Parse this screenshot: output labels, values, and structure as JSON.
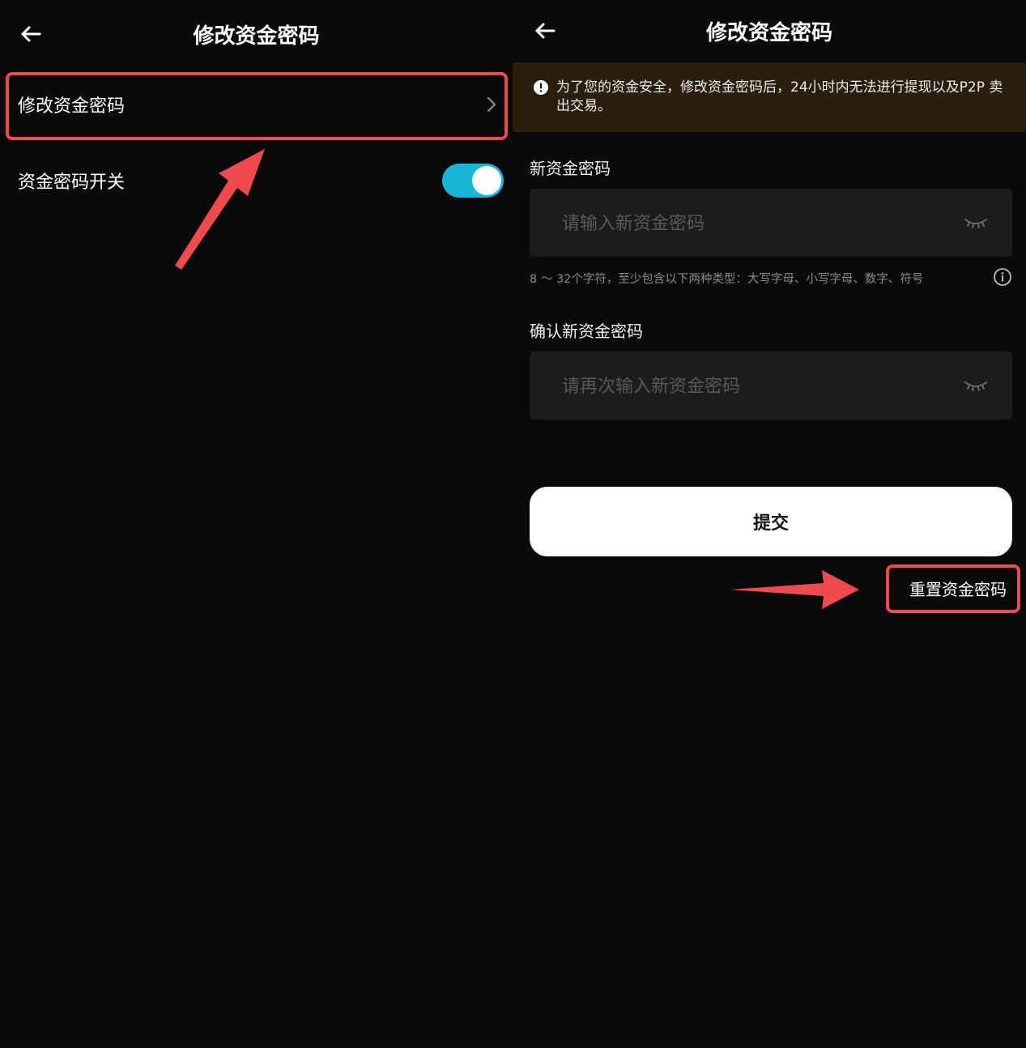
{
  "left": {
    "title": "修改资金密码",
    "rows": [
      {
        "label": "修改资金密码"
      },
      {
        "label": "资金密码开关",
        "toggle_on": true
      }
    ]
  },
  "right": {
    "title": "修改资金密码",
    "notice": "为了您的资金安全，修改资金密码后，24小时内无法进行提现以及P2P 卖出交易。",
    "new_password": {
      "label": "新资金密码",
      "placeholder": "请输入新资金密码"
    },
    "hint": "8 ～ 32个字符，至少包含以下两种类型：大写字母、小写字母、数字、符号",
    "confirm_password": {
      "label": "确认新资金密码",
      "placeholder": "请再次输入新资金密码"
    },
    "submit_label": "提交",
    "reset_label": "重置资金密码"
  },
  "colors": {
    "background": "#0a0a0a",
    "toggle_on": "#16b7d6",
    "highlight": "#ef4a4f",
    "notice_bg": "#2a1f0e",
    "input_bg": "#1c1c1c"
  },
  "icons": [
    "back-arrow-icon",
    "chevron-right-icon",
    "warning-icon",
    "eye-closed-icon",
    "info-icon"
  ]
}
